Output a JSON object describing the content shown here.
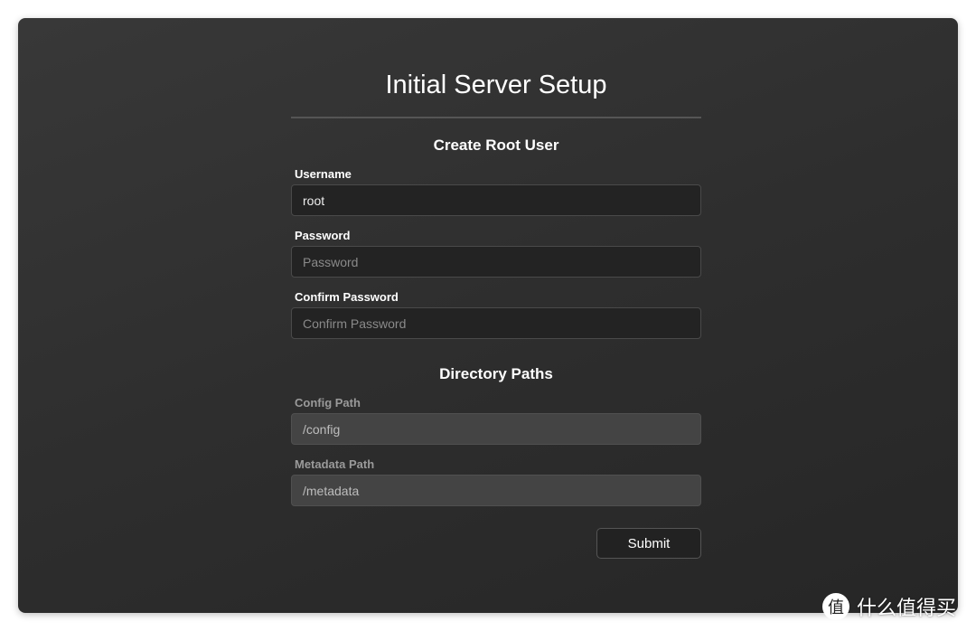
{
  "title": "Initial Server Setup",
  "sections": {
    "root_user": {
      "heading": "Create Root User",
      "username": {
        "label": "Username",
        "value": "root"
      },
      "password": {
        "label": "Password",
        "placeholder": "Password"
      },
      "confirm_password": {
        "label": "Confirm Password",
        "placeholder": "Confirm Password"
      }
    },
    "paths": {
      "heading": "Directory Paths",
      "config": {
        "label": "Config Path",
        "value": "/config"
      },
      "metadata": {
        "label": "Metadata Path",
        "value": "/metadata"
      }
    }
  },
  "submit_label": "Submit",
  "watermark": {
    "logo": "值",
    "text": "什么值得买"
  }
}
